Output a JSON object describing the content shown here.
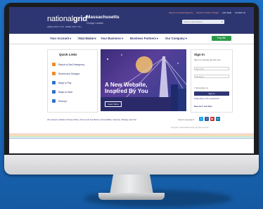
{
  "header": {
    "logo_light": "national",
    "logo_bold": "grid",
    "tagline": "HERE WITH YOU. HERE FOR YOU.",
    "region": "Massachusetts",
    "change_location": "Change Location",
    "util_gas": "Report a Gas Emergency",
    "util_outage": "Report a Power Outage",
    "util_lang": "Let's Help",
    "util_contact": "Contact Us",
    "search_placeholder": "Search nationalGrid"
  },
  "nav": {
    "items": [
      {
        "label": "Your Account ▾"
      },
      {
        "label": "Your Home ▾"
      },
      {
        "label": "Your Business ▾"
      },
      {
        "label": "Business Partners ▾"
      },
      {
        "label": "Our Company ▾"
      }
    ],
    "pay_label": "Pay Bill"
  },
  "quick_links": {
    "title": "Quick Links",
    "items": [
      {
        "label": "Report a Gas Emergency"
      },
      {
        "label": "Storms and Outages"
      },
      {
        "label": "Ways to Pay"
      },
      {
        "label": "Ways to Save"
      },
      {
        "label": "Moving?"
      }
    ]
  },
  "hero": {
    "title_line1": "A New Website,",
    "title_line2": "Inspired By You",
    "button": "Learn More"
  },
  "signin": {
    "title": "Sign In",
    "text": "Sign in to securely pay and more",
    "username_placeholder": "Sign In ID",
    "password_placeholder": "Password",
    "remember": "Remember me",
    "button": "Sign In",
    "forgot": "Forgot Sign In ID or password?",
    "new_user": "New user? Join Now"
  },
  "footer": {
    "links": "All | Careers | Media | Privacy Policy | Terms and Conditions | Accessibility | Security | Pledge | Opt Out",
    "language": "Select Language ▾",
    "copyright": "Copyright © 2022 National Grid. All rights reserved."
  }
}
